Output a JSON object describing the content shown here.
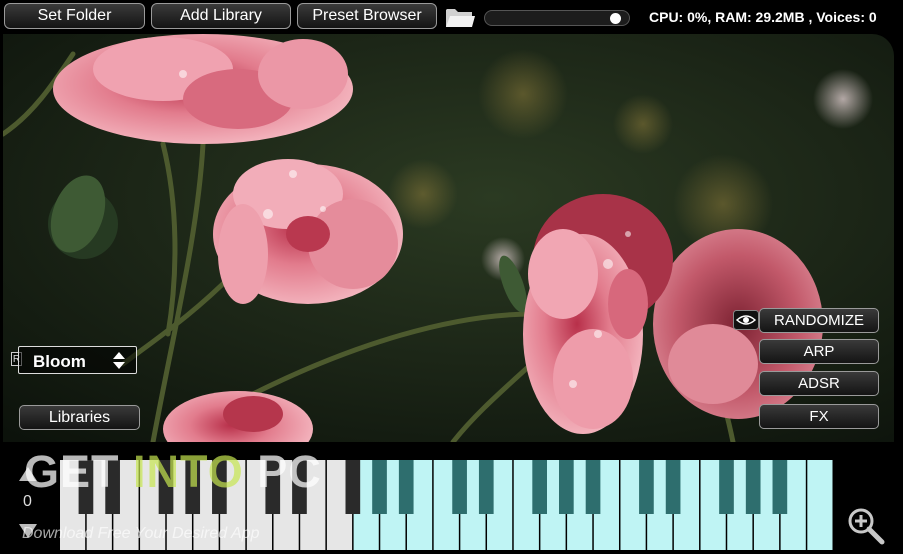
{
  "toolbar": {
    "set_folder_label": "Set Folder",
    "add_library_label": "Add Library",
    "preset_browser_label": "Preset Browser",
    "folder_icon": "folder-icon",
    "volume_level": 0.94,
    "status_text": "CPU: 0%, RAM: 29.2MB , Voices: 0"
  },
  "panel": {
    "preset_badge": "R",
    "preset_name": "Bloom",
    "libraries_label": "Libraries",
    "eye_icon": "eye-icon",
    "randomize_label": "RANDOMIZE",
    "arp_label": "ARP",
    "adsr_label": "ADSR",
    "fx_label": "FX"
  },
  "keyboard": {
    "octave_value": "0",
    "octave_up_icon": "triangle-up-icon",
    "octave_down_icon": "triangle-down-icon",
    "white_key_count": 29,
    "highlight_start_key": 11,
    "zoom_icon": "zoom-in-icon"
  },
  "watermark": {
    "part1": "GET ",
    "part2": "INTO",
    "part3": " PC",
    "tagline": "Download Free Your Desired App"
  },
  "colors": {
    "key_white": "#e6e6e6",
    "key_highlight": "#bff4f4",
    "button_border": "#9a9a9a"
  }
}
